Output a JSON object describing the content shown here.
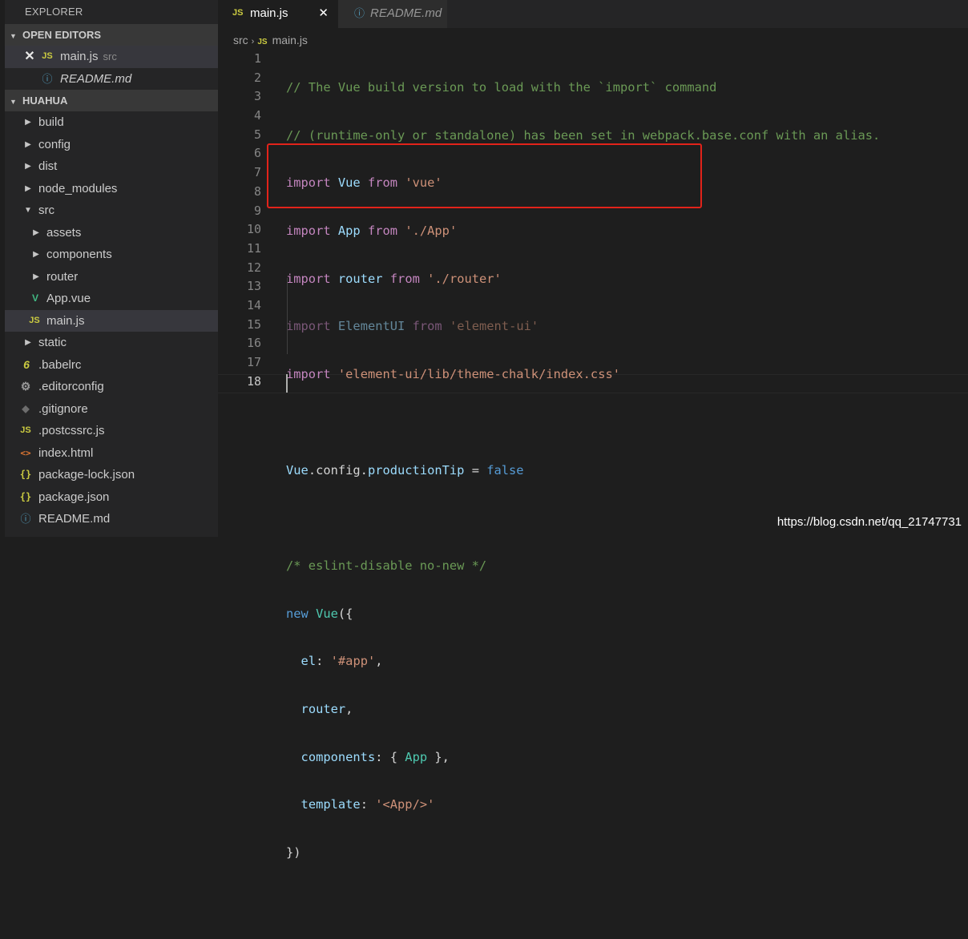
{
  "sidebar": {
    "title": "EXPLORER",
    "open_editors": {
      "header": "OPEN EDITORS",
      "items": [
        {
          "name": "main.js",
          "desc": "src",
          "icon": "JS"
        },
        {
          "name": "README.md",
          "desc": "",
          "icon": "ⓘ"
        }
      ]
    },
    "project": {
      "header": "HUAHUA",
      "items": [
        {
          "name": "build"
        },
        {
          "name": "config"
        },
        {
          "name": "dist"
        },
        {
          "name": "node_modules"
        },
        {
          "name": "src"
        },
        {
          "name": "assets"
        },
        {
          "name": "components"
        },
        {
          "name": "router"
        },
        {
          "name": "App.vue"
        },
        {
          "name": "main.js"
        },
        {
          "name": "static"
        },
        {
          "name": ".babelrc"
        },
        {
          "name": ".editorconfig"
        },
        {
          "name": ".gitignore"
        },
        {
          "name": ".postcssrc.js"
        },
        {
          "name": "index.html"
        },
        {
          "name": "package-lock.json"
        },
        {
          "name": "package.json"
        },
        {
          "name": "README.md"
        }
      ]
    }
  },
  "tabs": [
    {
      "label": "main.js",
      "icon": "JS",
      "active": true
    },
    {
      "label": "README.md",
      "icon": "ⓘ",
      "active": false
    }
  ],
  "breadcrumb": {
    "folder": "src",
    "file": "main.js",
    "file_icon": "JS"
  },
  "editor": {
    "line_numbers": [
      "1",
      "2",
      "3",
      "4",
      "5",
      "6",
      "7",
      "8",
      "9",
      "10",
      "11",
      "12",
      "13",
      "14",
      "15",
      "16",
      "17",
      "18"
    ],
    "code": {
      "l1": "// The Vue build version to load with the `import` command",
      "l2": "// (runtime-only or standalone) has been set in webpack.base.conf with an alias.",
      "l3": {
        "kw": "import",
        "id": "Vue",
        "from": "from",
        "str": "'vue'"
      },
      "l4": {
        "kw": "import",
        "id": "App",
        "from": "from",
        "str": "'./App'"
      },
      "l5": {
        "kw": "import",
        "id": "router",
        "from": "from",
        "str": "'./router'"
      },
      "l6": {
        "kw": "import",
        "id": "ElementUI",
        "from": "from",
        "str": "'element-ui'"
      },
      "l7": {
        "kw": "import",
        "str": "'element-ui/lib/theme-chalk/index.css'"
      },
      "l9": {
        "a": "Vue",
        "b": ".config.",
        "c": "productionTip",
        "d": " = ",
        "e": "false"
      },
      "l11": "/* eslint-disable no-new */",
      "l12": {
        "kw": "new",
        "cls": "Vue",
        "pn": "({"
      },
      "l13": {
        "key": "el",
        "pn": ": ",
        "str": "'#app'",
        "end": ","
      },
      "l14": {
        "key": "router",
        "end": ","
      },
      "l15": {
        "key": "components",
        "pn": ": { ",
        "cls": "App",
        "end": " },"
      },
      "l16": {
        "key": "template",
        "pn": ": ",
        "str": "'<App/>'"
      },
      "l17": "})"
    }
  },
  "watermark": "https://blog.csdn.net/qq_21747731",
  "colors": {
    "highlight_box": "#e2231a",
    "keyword": "#c586c0",
    "string": "#ce9178",
    "comment": "#6a9955",
    "identifier": "#9cdcfe"
  }
}
